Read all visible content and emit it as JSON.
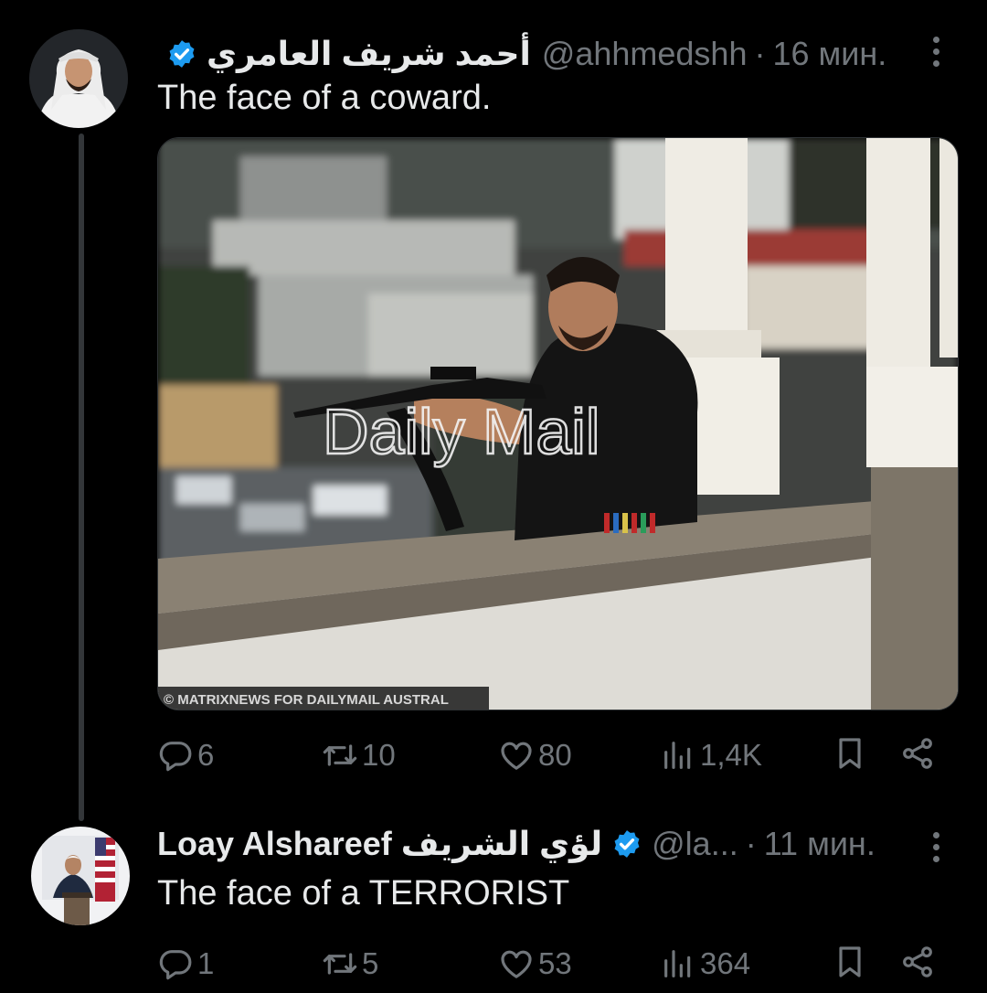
{
  "tweets": [
    {
      "display_name": "أحمد شريف العامري",
      "handle": "@ahhmedshh",
      "dot": "·",
      "time": "16 мин.",
      "text": "The face of a coward.",
      "media": {
        "watermark": "Daily Mail",
        "credit": "© MATRIXNEWS FOR DAILYMAIL AUSTRAL"
      },
      "stats": {
        "replies": "6",
        "reposts": "10",
        "likes": "80",
        "views": "1,4K"
      }
    },
    {
      "display_name": "Loay Alshareef لؤي الشريف",
      "handle": "@la...",
      "dot": "·",
      "time": "11 мин.",
      "text": "The face of a TERRORIST",
      "stats": {
        "replies": "1",
        "reposts": "5",
        "likes": "53",
        "views": "364"
      }
    }
  ],
  "colors": {
    "background": "#000000",
    "primary_text": "#e7e9ea",
    "secondary_text": "#71767b",
    "verified_blue": "#1d9bf0",
    "thread_line": "#333639"
  },
  "icons": [
    "verified-badge-icon",
    "more-options-icon",
    "reply-icon",
    "repost-icon",
    "like-icon",
    "views-icon",
    "bookmark-icon",
    "share-icon"
  ]
}
